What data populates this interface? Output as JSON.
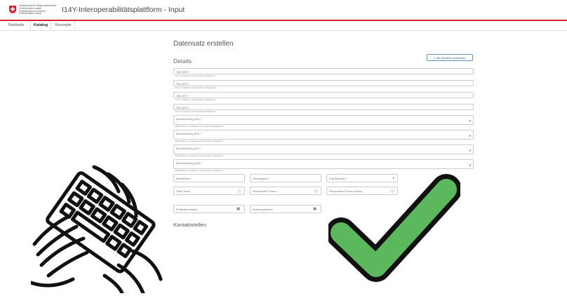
{
  "header": {
    "confederation_lines": [
      "Schweizerische Eidgenossenschaft",
      "Confédération suisse",
      "Confederazione Svizzera",
      "Confederaziun svizra"
    ],
    "app_title": "I14Y-Interoperabilitätsplattform - Input",
    "accent_color": "#d8232a"
  },
  "nav": {
    "tabs": [
      {
        "label": "Startseite"
      },
      {
        "label": "Katalog",
        "active": true
      },
      {
        "label": "Konzepte"
      }
    ]
  },
  "main": {
    "page_title": "Datensatz erstellen",
    "details_title": "Details",
    "expand_languages_button": "Alle Sprachen ausblenden",
    "title_fields": [
      {
        "label": "Titel (DE) *",
        "hint": "Titel in mindestens einer Sprache ist obligatorisch"
      },
      {
        "label": "Titel (FR) *",
        "hint": "Titel in mindestens einer Sprache ist obligatorisch"
      },
      {
        "label": "Titel (IT) *",
        "hint": "Titel in mindestens einer Sprache ist obligatorisch"
      },
      {
        "label": "Titel (EN) *",
        "hint": "Titel in mindestens einer Sprache ist obligatorisch"
      }
    ],
    "description_fields": [
      {
        "label": "Beschreibung (DE) *",
        "hint": "Beschreibung in mindestens einer Sprache ist obligatorisch"
      },
      {
        "label": "Beschreibung (FR) *",
        "hint": "Beschreibung in mindestens einer Sprache ist obligatorisch"
      },
      {
        "label": "Beschreibung (IT) *",
        "hint": "Beschreibung in mindestens einer Sprache ist obligatorisch"
      },
      {
        "label": "Beschreibung (EN) *",
        "hint": "Beschreibung in mindestens einer Sprache ist obligatorisch"
      }
    ],
    "row1": {
      "identifier": "Identifikator *",
      "publisher": "Herausgeber *",
      "access_rights": "Zugriffsrechte *"
    },
    "row2": {
      "data_owner": "Data Owner",
      "responsible_person": "Responsible Person",
      "responsible_deputy": "Responsible Person Deputy"
    },
    "row3": {
      "publication_date": "Publikationsdatum",
      "modification_date": "Änderungsdatum"
    },
    "contacts_title": "Kontaktstellen"
  },
  "overlay": {
    "hand_icon": "typing-hands-icon",
    "check_icon": "checkmark-icon",
    "check_color": "#5cb85c"
  }
}
